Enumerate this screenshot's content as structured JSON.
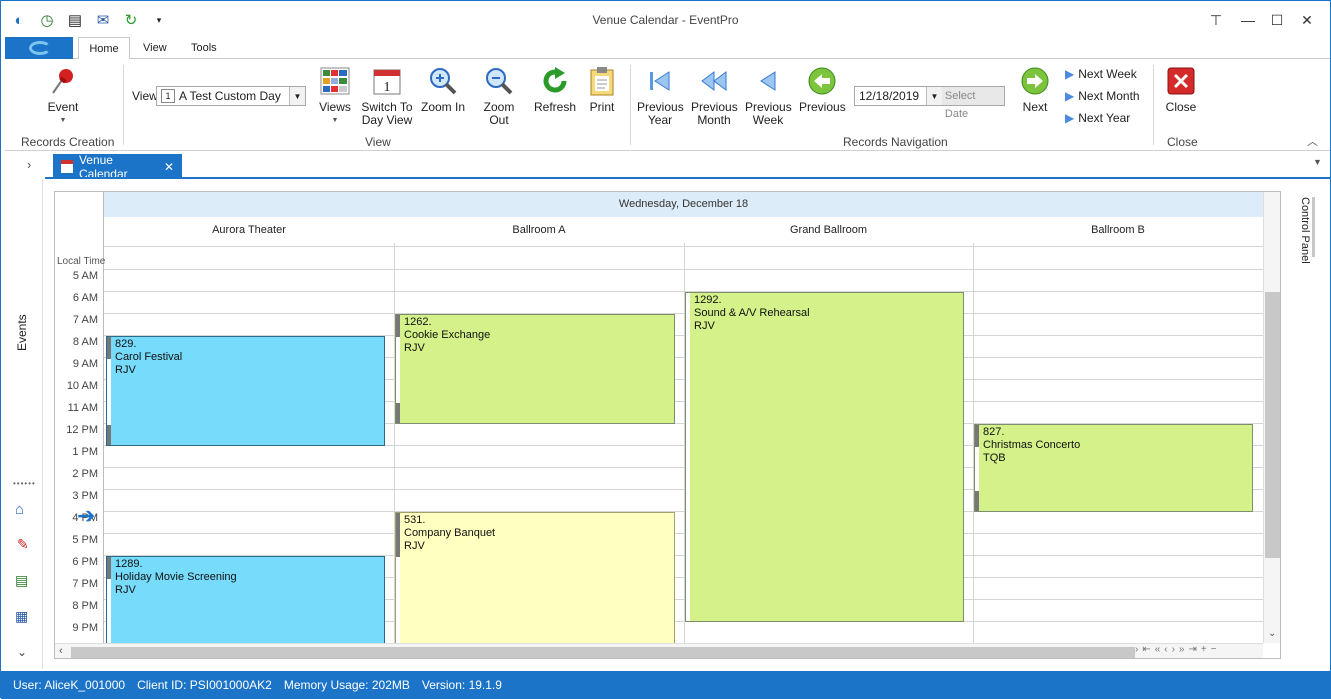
{
  "window": {
    "title": "Venue Calendar - EventPro"
  },
  "ribbon_tabs": [
    "Home",
    "View",
    "Tools"
  ],
  "records_creation": {
    "event_label": "Event",
    "group_label": "Records Creation"
  },
  "view_group": {
    "view_label": "View",
    "view_value": "A Test Custom Day",
    "views_label": "Views",
    "switch_label_1": "Switch To",
    "switch_label_2": "Day View",
    "zoom_in": "Zoom In",
    "zoom_out": "Zoom Out",
    "refresh": "Refresh",
    "print": "Print",
    "group_label": "View"
  },
  "nav_group": {
    "prev_year_1": "Previous",
    "prev_year_2": "Year",
    "prev_month_1": "Previous",
    "prev_month_2": "Month",
    "prev_week_1": "Previous",
    "prev_week_2": "Week",
    "previous": "Previous",
    "date_value": "12/18/2019",
    "select_date": "Select Date",
    "next": "Next",
    "next_week": "Next Week",
    "next_month": "Next Month",
    "next_year": "Next Year",
    "group_label": "Records Navigation"
  },
  "close_group": {
    "close": "Close",
    "group_label": "Close"
  },
  "doc_tab": {
    "label": "Venue Calendar"
  },
  "left_rail": {
    "events_label": "Events"
  },
  "control_panel_label": "Control Panel",
  "calendar": {
    "date_header": "Wednesday, December 18",
    "local_time_label": "Local Time",
    "venues": [
      "Aurora Theater",
      "Ballroom A",
      "Grand Ballroom",
      "Ballroom B"
    ],
    "hours": [
      "5 AM",
      "6 AM",
      "7 AM",
      "8 AM",
      "9 AM",
      "10 AM",
      "11 AM",
      "12 PM",
      "1 PM",
      "2 PM",
      "3 PM",
      "4 PM",
      "5 PM",
      "6 PM",
      "7 PM",
      "8 PM",
      "9 PM"
    ],
    "events": [
      {
        "id": "829.",
        "name": "Carol Festival",
        "code": "RJV",
        "color": "#77dbfb"
      },
      {
        "id": "1289.",
        "name": "Holiday Movie Screening",
        "code": "RJV",
        "color": "#77dbfb"
      },
      {
        "id": "1262.",
        "name": "Cookie Exchange",
        "code": "RJV",
        "color": "#d4f18a"
      },
      {
        "id": "531.",
        "name": "Company Banquet",
        "code": "RJV",
        "color": "#ffffc0"
      },
      {
        "id": "1292.",
        "name": "Sound & A/V Rehearsal",
        "code": "RJV",
        "color": "#d4f18a"
      },
      {
        "id": "827.",
        "name": "Christmas Concerto",
        "code": "TQB",
        "color": "#d4f18a"
      }
    ]
  },
  "status": {
    "user": "User: AliceK_001000",
    "client": "Client ID: PSI001000AK2",
    "memory": "Memory Usage: 202MB",
    "version": "Version: 19.1.9"
  }
}
